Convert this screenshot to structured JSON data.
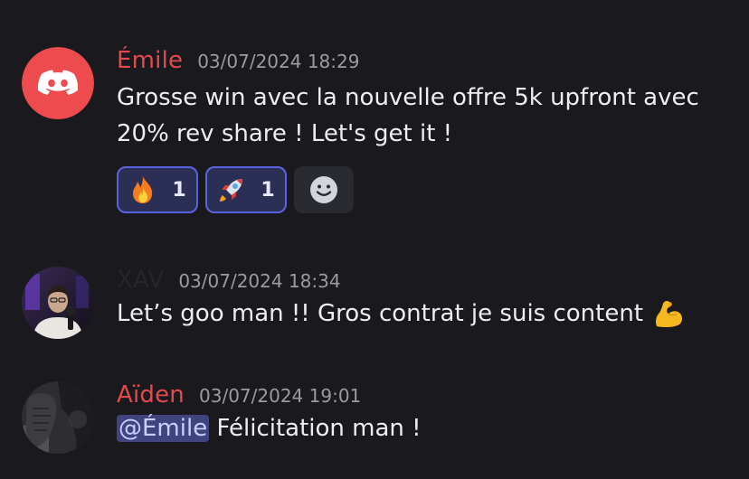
{
  "messages": [
    {
      "author": "Émile",
      "author_color": "#e14a4f",
      "timestamp": "03/07/2024 18:29",
      "text_line1": "Grosse win avec la nouvelle offre 5k upfront avec",
      "text_line2": "20% rev share ! Let's get it !",
      "avatar_icon": "discord-logo-icon",
      "reactions": [
        {
          "emoji": "fire-icon",
          "count": "1"
        },
        {
          "emoji": "rocket-icon",
          "count": "1"
        }
      ],
      "add_reaction_icon": "smiley-icon"
    },
    {
      "author": "XAV",
      "author_color": "#25262b",
      "timestamp": "03/07/2024 18:34",
      "text": "Let’s goo man !! Gros contrat je suis content",
      "trailing_emoji": "flexed-biceps-icon",
      "avatar_icon": "user-photo-avatar"
    },
    {
      "author": "Aïden",
      "author_color": "#e14a4f",
      "timestamp": "03/07/2024 19:01",
      "mention": "@Émile",
      "text": " Félicitation man !",
      "avatar_icon": "user-photo-avatar"
    }
  ],
  "colors": {
    "background": "#1a1a1e",
    "reaction_border": "#5a62e0",
    "reaction_bg": "#2c2f55",
    "mention_bg": "#3f447f",
    "discord_red": "#ee4b4f"
  }
}
